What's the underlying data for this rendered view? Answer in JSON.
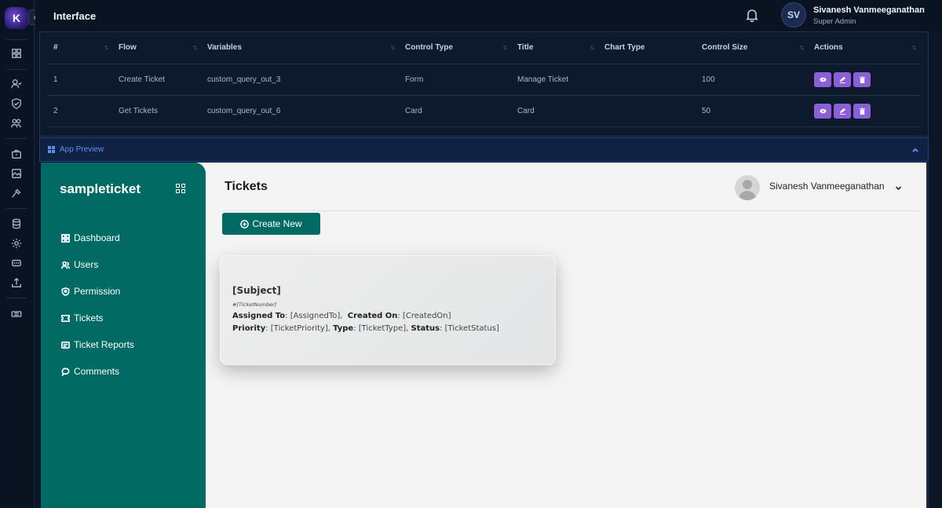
{
  "topbar": {
    "title": "Interface",
    "user_initials": "SV",
    "user_name": "Sivanesh Vanmeeganathan",
    "user_role": "Super Admin"
  },
  "table": {
    "headers": [
      "#",
      "Flow",
      "Variables",
      "Control Type",
      "Title",
      "Chart Type",
      "Control Size",
      "Actions"
    ],
    "rows": [
      {
        "num": "1",
        "flow": "Create Ticket",
        "variables": "custom_query_out_3",
        "control_type": "Form",
        "title": "Manage Ticket",
        "chart_type": "",
        "control_size": "100"
      },
      {
        "num": "2",
        "flow": "Get Tickets",
        "variables": "custom_query_out_6",
        "control_type": "Card",
        "title": "Card",
        "chart_type": "",
        "control_size": "50"
      }
    ],
    "action_color": "#8b5fd6"
  },
  "preview": {
    "label": "App Preview"
  },
  "app": {
    "name": "sampleticket",
    "nav": [
      {
        "label": "Dashboard",
        "icon": "dashboard-icon"
      },
      {
        "label": "Users",
        "icon": "users-icon"
      },
      {
        "label": "Permission",
        "icon": "permission-icon"
      },
      {
        "label": "Tickets",
        "icon": "tickets-icon"
      },
      {
        "label": "Ticket Reports",
        "icon": "reports-icon"
      },
      {
        "label": "Comments",
        "icon": "comments-icon"
      }
    ],
    "page_title": "Tickets",
    "user_name": "Sivanesh Vanmeeganathan",
    "create_button": "Create New",
    "brand_color": "#016b63"
  },
  "card": {
    "subject": "[Subject]",
    "number": "#[TicketNumber]",
    "assigned_label": "Assigned To",
    "assigned_value": ": [AssignedTo],",
    "created_label": "Created On",
    "created_value": ": [CreatedOn]",
    "priority_label": "Priority",
    "priority_value": ": [TicketPriority],",
    "type_label": "Type",
    "type_value": ": [TicketType],",
    "status_label": "Status",
    "status_value": ": [TicketStatus]"
  }
}
